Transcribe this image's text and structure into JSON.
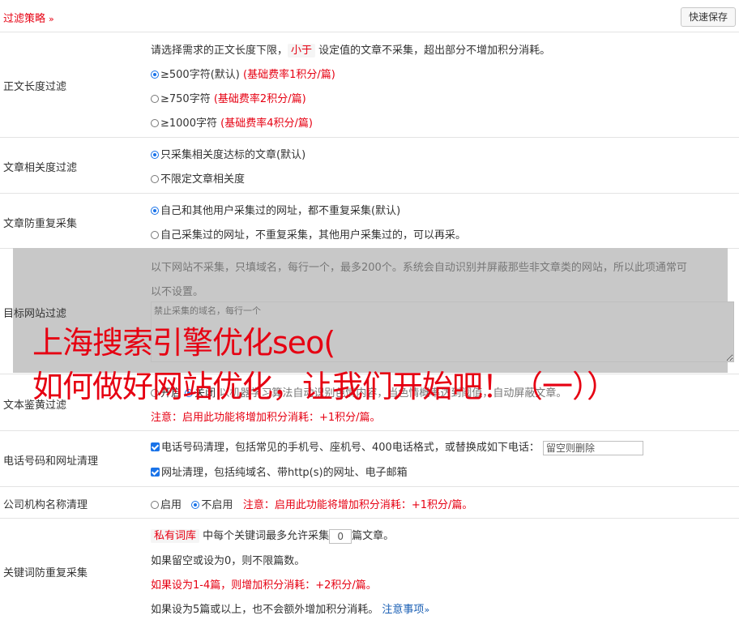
{
  "header": {
    "title": "过滤策略",
    "chevron": "»",
    "quick_save": "快速保存"
  },
  "length_filter": {
    "label": "正文长度过滤",
    "intro_pre": "请选择需求的正文长度下限，",
    "intro_tag": "小于",
    "intro_post": "设定值的文章不采集，超出部分不增加积分消耗。",
    "options": [
      {
        "text": "≥500字符(默认)",
        "note": "(基础费率1积分/篇)",
        "selected": true
      },
      {
        "text": "≥750字符",
        "note": "(基础费率2积分/篇)",
        "selected": false
      },
      {
        "text": "≥1000字符",
        "note": "(基础费率4积分/篇)",
        "selected": false
      }
    ]
  },
  "relevance": {
    "label": "文章相关度过滤",
    "options": [
      {
        "text": "只采集相关度达标的文章(默认)",
        "selected": true
      },
      {
        "text": "不限定文章相关度",
        "selected": false
      }
    ]
  },
  "dedupe": {
    "label": "文章防重复采集",
    "options": [
      {
        "text": "自己和其他用户采集过的网址，都不重复采集(默认)",
        "selected": true
      },
      {
        "text": "自己采集过的网址，不重复采集，其他用户采集过的，可以再采。",
        "selected": false
      }
    ]
  },
  "target_site": {
    "label": "目标网站过滤",
    "desc_line1": "以下网站不采集，只填域名，每行一个，最多200个。系统会自动识别并屏蔽那些非文章类的网站，所以此项通常可",
    "desc_line2": "以不设置。",
    "placeholder": "禁止采集的域名，每行一个"
  },
  "porn_filter": {
    "label": "文本鉴黄过滤",
    "option_off": "开启",
    "option_on": "关闭",
    "desc": "以机器学习算法自动识别色情内容，当色情概率达到阈值，自动屏蔽文章。",
    "note": "注意：启用此功能将增加积分消耗：+1积分/篇。"
  },
  "phone_clean": {
    "label": "电话号码和网址清理",
    "phone_text": "电话号码清理，包括常见的手机号、座机号、400电话格式，或替换成如下电话：",
    "phone_placeholder": "留空则删除",
    "url_text": "网址清理，包括纯域名、带http(s)的网址、电子邮箱"
  },
  "org_clean": {
    "label": "公司机构名称清理",
    "enable": "启用",
    "disable": "不启用",
    "note": "注意：启用此功能将增加积分消耗：+1积分/篇。"
  },
  "keyword_dedupe": {
    "label": "关键词防重复采集",
    "tag": "私有词库",
    "line1_pre": "中每个关键词最多允许采集",
    "value": "0",
    "line1_post": "篇文章。",
    "line2": "如果留空或设为0，则不限篇数。",
    "line3": "如果设为1-4篇，则增加积分消耗：+2积分/篇。",
    "line4": "如果设为5篇或以上，也不会额外增加积分消耗。",
    "link": "注意事项",
    "link_chevron": "»"
  },
  "watermark": {
    "line1": "上海搜索引擎优化seo(",
    "line2": "如何做好网站优化，让我们开始吧！（一））"
  }
}
